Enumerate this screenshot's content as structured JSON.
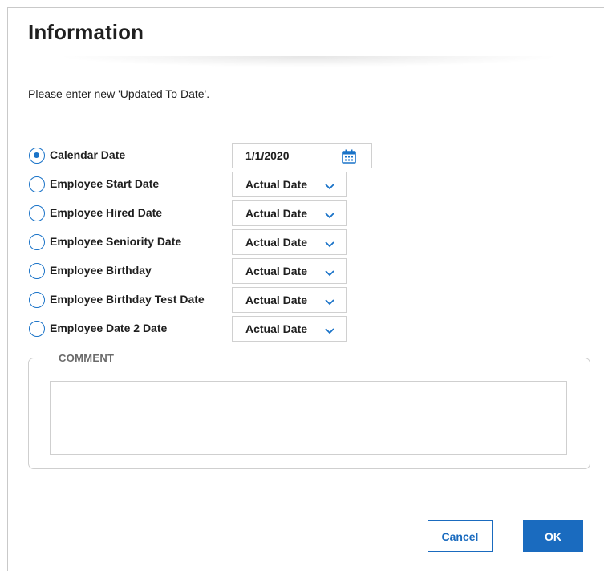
{
  "dialog": {
    "title": "Information",
    "instruction": "Please enter new 'Updated To Date'."
  },
  "options": [
    {
      "label": "Calendar Date",
      "checked": true,
      "control": "date",
      "value": "1/1/2020",
      "icon": "calendar-icon"
    },
    {
      "label": "Employee Start Date",
      "checked": false,
      "control": "select",
      "value": "Actual Date",
      "icon": "chevron-down-icon"
    },
    {
      "label": "Employee Hired Date",
      "checked": false,
      "control": "select",
      "value": "Actual Date",
      "icon": "chevron-down-icon"
    },
    {
      "label": "Employee Seniority Date",
      "checked": false,
      "control": "select",
      "value": "Actual Date",
      "icon": "chevron-down-icon"
    },
    {
      "label": "Employee Birthday",
      "checked": false,
      "control": "select",
      "value": "Actual Date",
      "icon": "chevron-down-icon"
    },
    {
      "label": "Employee Birthday Test Date",
      "checked": false,
      "control": "select",
      "value": "Actual Date",
      "icon": "chevron-down-icon"
    },
    {
      "label": "Employee Date 2 Date",
      "checked": false,
      "control": "select",
      "value": "Actual Date",
      "icon": "chevron-down-icon"
    }
  ],
  "comment": {
    "legend": "COMMENT",
    "value": ""
  },
  "buttons": {
    "cancel": "Cancel",
    "ok": "OK"
  },
  "colors": {
    "accent": "#1a6bbf",
    "radio": "#1a73c8",
    "legend": "#6b6b6b",
    "border": "#d0d0d0"
  }
}
